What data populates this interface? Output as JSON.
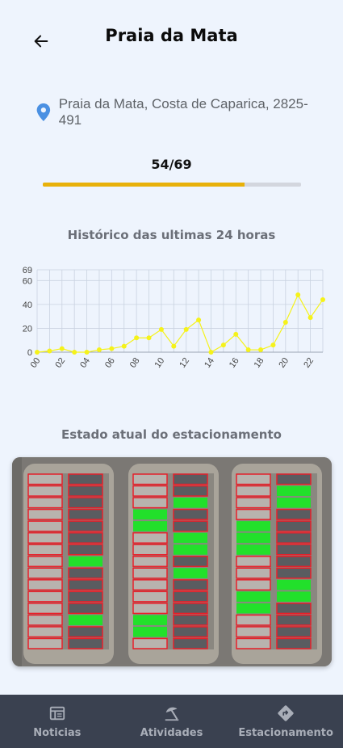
{
  "header": {
    "title": "Praia da Mata"
  },
  "location": {
    "address": "Praia da Mata, Costa de Caparica, 2825-491"
  },
  "occupancy": {
    "text": "54/69",
    "occupied": 54,
    "capacity": 69
  },
  "history": {
    "title": "Histórico das ultimas 24 horas"
  },
  "current": {
    "title": "Estado atual do estacionamento"
  },
  "colors": {
    "accent": "#e8b10a",
    "series": "#f5f21a",
    "free_spot": "#22e02b",
    "occupied_spot": "#e8202a"
  },
  "chart_data": {
    "type": "line",
    "title": "",
    "xlabel": "",
    "ylabel": "",
    "x": [
      0,
      1,
      2,
      3,
      4,
      5,
      6,
      7,
      8,
      9,
      10,
      11,
      12,
      13,
      14,
      15,
      16,
      17,
      18,
      19,
      20,
      21,
      22,
      23
    ],
    "xtick_labels": [
      "00",
      "02",
      "04",
      "06",
      "08",
      "10",
      "12",
      "14",
      "16",
      "18",
      "20",
      "22"
    ],
    "ytick_labels": [
      "0",
      "20",
      "40",
      "60",
      "69"
    ],
    "ylim": [
      0,
      69
    ],
    "grid": true,
    "series": [
      {
        "values": [
          0,
          1,
          3,
          0,
          0,
          2,
          3,
          5,
          12,
          12,
          19,
          5,
          19,
          27,
          0,
          6,
          15,
          2,
          2,
          6,
          25,
          48,
          29,
          44
        ]
      }
    ]
  },
  "parking": {
    "columns": [
      {
        "spots": [
          1,
          1,
          1,
          1,
          1,
          1,
          1,
          1,
          1,
          1,
          1,
          1,
          1,
          1,
          1
        ],
        "spots_right": [
          1,
          1,
          1,
          1,
          1,
          1,
          1,
          0,
          1,
          1,
          1,
          1,
          0,
          1,
          1
        ]
      },
      {
        "spots": [
          1,
          1,
          1,
          0,
          0,
          1,
          1,
          1,
          1,
          1,
          1,
          1,
          0,
          0,
          1
        ],
        "spots_right": [
          1,
          1,
          0,
          1,
          1,
          0,
          0,
          1,
          0,
          1,
          1,
          1,
          1,
          1,
          1
        ]
      },
      {
        "spots": [
          1,
          1,
          1,
          1,
          0,
          0,
          0,
          1,
          1,
          1,
          0,
          0,
          1,
          1,
          1
        ],
        "spots_right": [
          1,
          0,
          0,
          1,
          1,
          1,
          1,
          1,
          1,
          0,
          0,
          1,
          1,
          1,
          1
        ]
      }
    ]
  },
  "nav": [
    {
      "label": "Noticias",
      "icon": "newspaper-icon"
    },
    {
      "label": "Atividades",
      "icon": "beach-umbrella-icon"
    },
    {
      "label": "Estacionamento",
      "icon": "directions-sign-icon"
    }
  ]
}
